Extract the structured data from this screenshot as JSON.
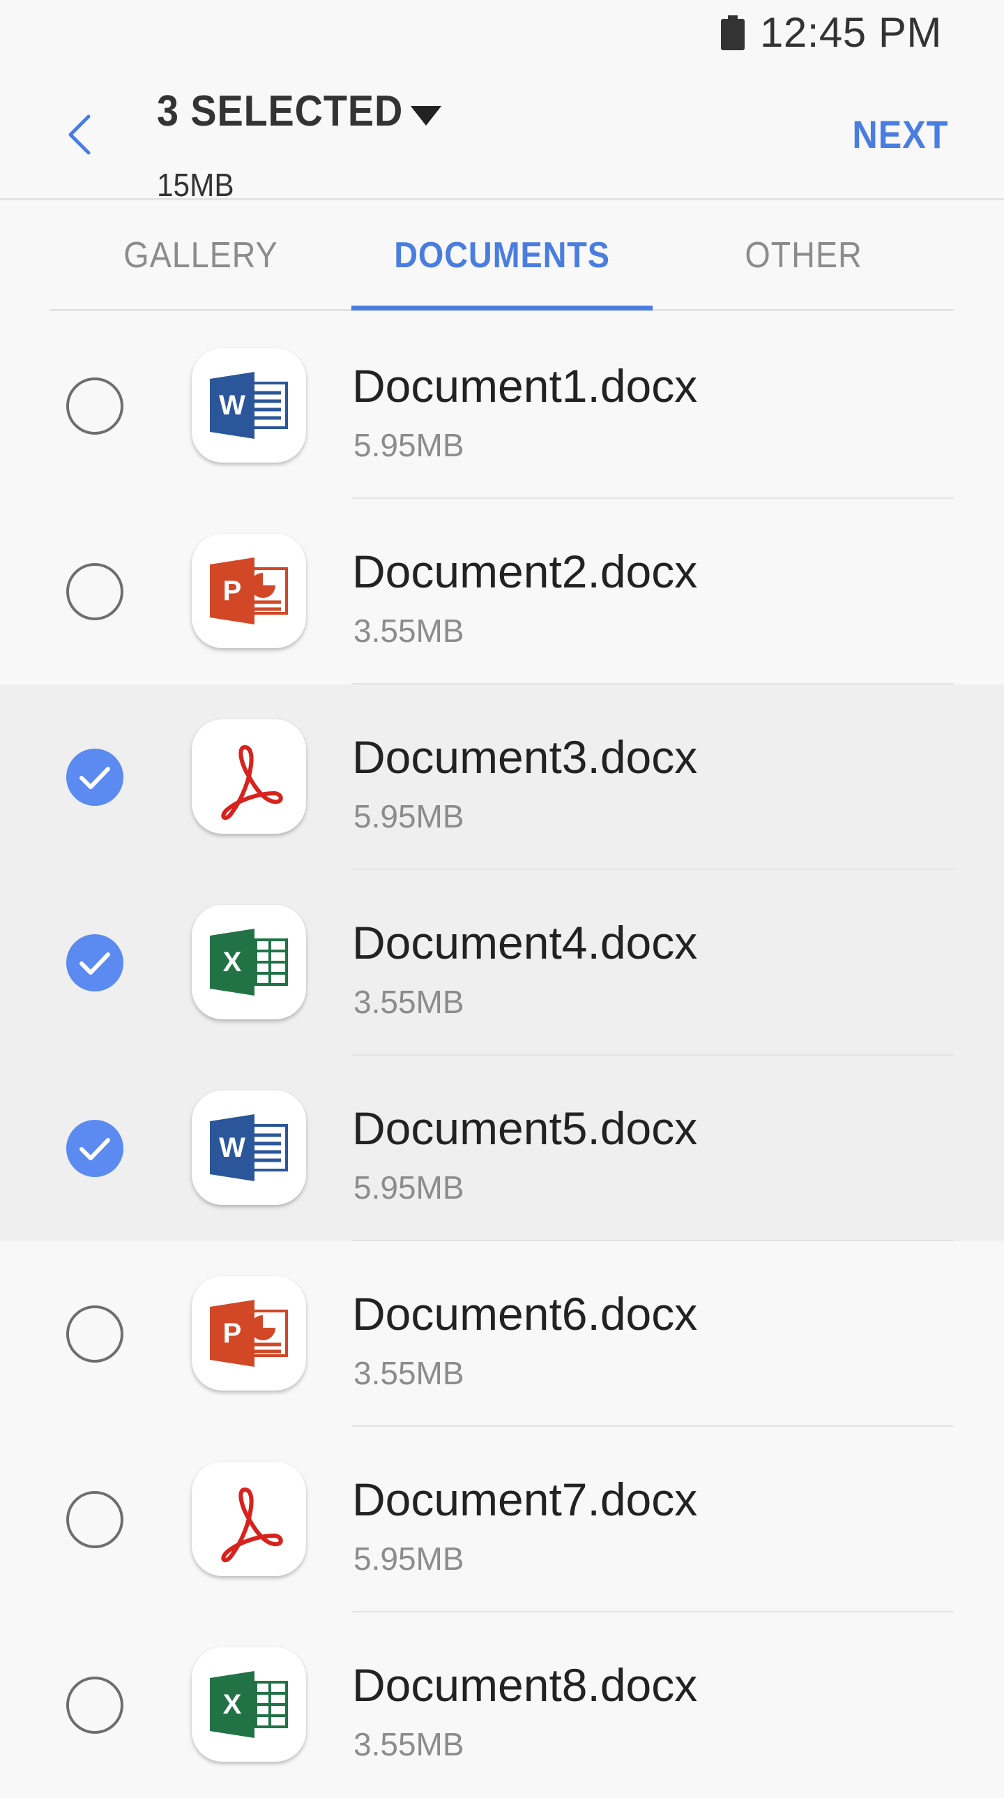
{
  "status_bar": {
    "time": "12:45 PM"
  },
  "header": {
    "title": "3 SELECTED",
    "subtitle": "15MB",
    "next_label": "NEXT"
  },
  "tabs": [
    {
      "label": "GALLERY",
      "active": false
    },
    {
      "label": "DOCUMENTS",
      "active": true
    },
    {
      "label": "OTHER",
      "active": false
    }
  ],
  "colors": {
    "accent": "#4a7de0",
    "checkbox_checked": "#5b8af0",
    "selected_row": "#efefef"
  },
  "files": [
    {
      "name": "Document1.docx",
      "size": "5.95MB",
      "icon": "word-icon",
      "selected": false
    },
    {
      "name": "Document2.docx",
      "size": "3.55MB",
      "icon": "powerpoint-icon",
      "selected": false
    },
    {
      "name": "Document3.docx",
      "size": "5.95MB",
      "icon": "pdf-icon",
      "selected": true
    },
    {
      "name": "Document4.docx",
      "size": "3.55MB",
      "icon": "excel-icon",
      "selected": true
    },
    {
      "name": "Document5.docx",
      "size": "5.95MB",
      "icon": "word-icon",
      "selected": true
    },
    {
      "name": "Document6.docx",
      "size": "3.55MB",
      "icon": "powerpoint-icon",
      "selected": false
    },
    {
      "name": "Document7.docx",
      "size": "5.95MB",
      "icon": "pdf-icon",
      "selected": false
    },
    {
      "name": "Document8.docx",
      "size": "3.55MB",
      "icon": "excel-icon",
      "selected": false
    }
  ]
}
